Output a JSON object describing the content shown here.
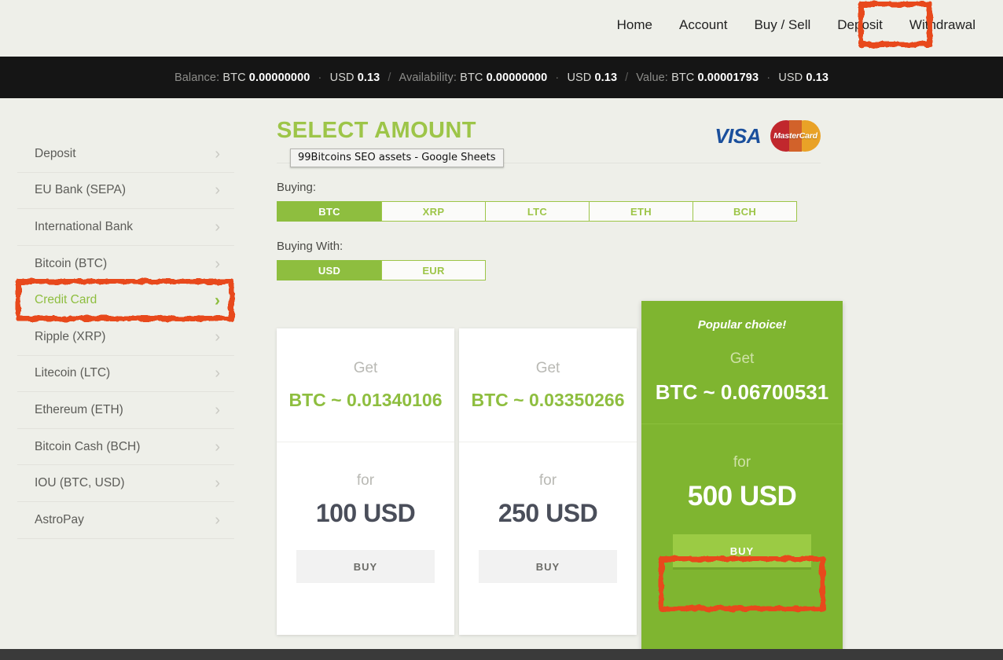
{
  "nav": {
    "items": [
      {
        "label": "Home",
        "name": "nav-home"
      },
      {
        "label": "Account",
        "name": "nav-account"
      },
      {
        "label": "Buy / Sell",
        "name": "nav-buy-sell"
      },
      {
        "label": "Deposit",
        "name": "nav-deposit"
      },
      {
        "label": "Withdrawal",
        "name": "nav-withdrawal"
      }
    ],
    "highlighted": "Deposit"
  },
  "balance": {
    "balance_label": "Balance:",
    "balance_btc_cur": "BTC",
    "balance_btc_val": "0.00000000",
    "balance_usd_cur": "USD",
    "balance_usd_val": "0.13",
    "availability_label": "Availability:",
    "availability_btc_cur": "BTC",
    "availability_btc_val": "0.00000000",
    "availability_usd_cur": "USD",
    "availability_usd_val": "0.13",
    "value_label": "Value:",
    "value_btc_cur": "BTC",
    "value_btc_val": "0.00001793",
    "value_usd_cur": "USD",
    "value_usd_val": "0.13",
    "separator": "/",
    "dot": "·"
  },
  "sidebar": {
    "items": [
      {
        "label": "Deposit",
        "active": false
      },
      {
        "label": "EU Bank (SEPA)",
        "active": false
      },
      {
        "label": "International Bank",
        "active": false
      },
      {
        "label": "Bitcoin (BTC)",
        "active": false
      },
      {
        "label": "Credit Card",
        "active": true
      },
      {
        "label": "Ripple (XRP)",
        "active": false
      },
      {
        "label": "Litecoin (LTC)",
        "active": false
      },
      {
        "label": "Ethereum (ETH)",
        "active": false
      },
      {
        "label": "Bitcoin Cash (BCH)",
        "active": false
      },
      {
        "label": "IOU (BTC, USD)",
        "active": false
      },
      {
        "label": "AstroPay",
        "active": false
      }
    ],
    "chevron": "›"
  },
  "main": {
    "title": "SELECT AMOUNT",
    "tooltip": "99Bitcoins SEO assets - Google Sheets",
    "buying_label": "Buying:",
    "buying_with_label": "Buying With:",
    "buying_options": [
      {
        "label": "BTC",
        "selected": true
      },
      {
        "label": "XRP",
        "selected": false
      },
      {
        "label": "LTC",
        "selected": false
      },
      {
        "label": "ETH",
        "selected": false
      },
      {
        "label": "BCH",
        "selected": false
      }
    ],
    "buying_with_options": [
      {
        "label": "USD",
        "selected": true
      },
      {
        "label": "EUR",
        "selected": false
      }
    ],
    "logos": {
      "visa": "VISA",
      "mastercard": "MasterCard"
    }
  },
  "cards": [
    {
      "get_label": "Get",
      "amount": "BTC ~ 0.01340106",
      "for_label": "for",
      "price": "100 USD",
      "buy_label": "BUY",
      "popular": false,
      "ribbon": ""
    },
    {
      "get_label": "Get",
      "amount": "BTC ~ 0.03350266",
      "for_label": "for",
      "price": "250 USD",
      "buy_label": "BUY",
      "popular": false,
      "ribbon": ""
    },
    {
      "get_label": "Get",
      "amount": "BTC ~ 0.06700531",
      "for_label": "for",
      "price": "500 USD",
      "buy_label": "BUY",
      "popular": true,
      "ribbon": "Popular choice!"
    }
  ],
  "colors": {
    "brand_green": "#8ebe3f",
    "popular_green": "#7fb530",
    "buy_green": "#9bcb44",
    "annotation_red": "#e8491f",
    "page_bg": "#eeefe9",
    "bar_black": "#151515"
  },
  "annotations": [
    {
      "name": "annotation-deposit-nav"
    },
    {
      "name": "annotation-credit-card"
    },
    {
      "name": "annotation-buy-500"
    }
  ]
}
